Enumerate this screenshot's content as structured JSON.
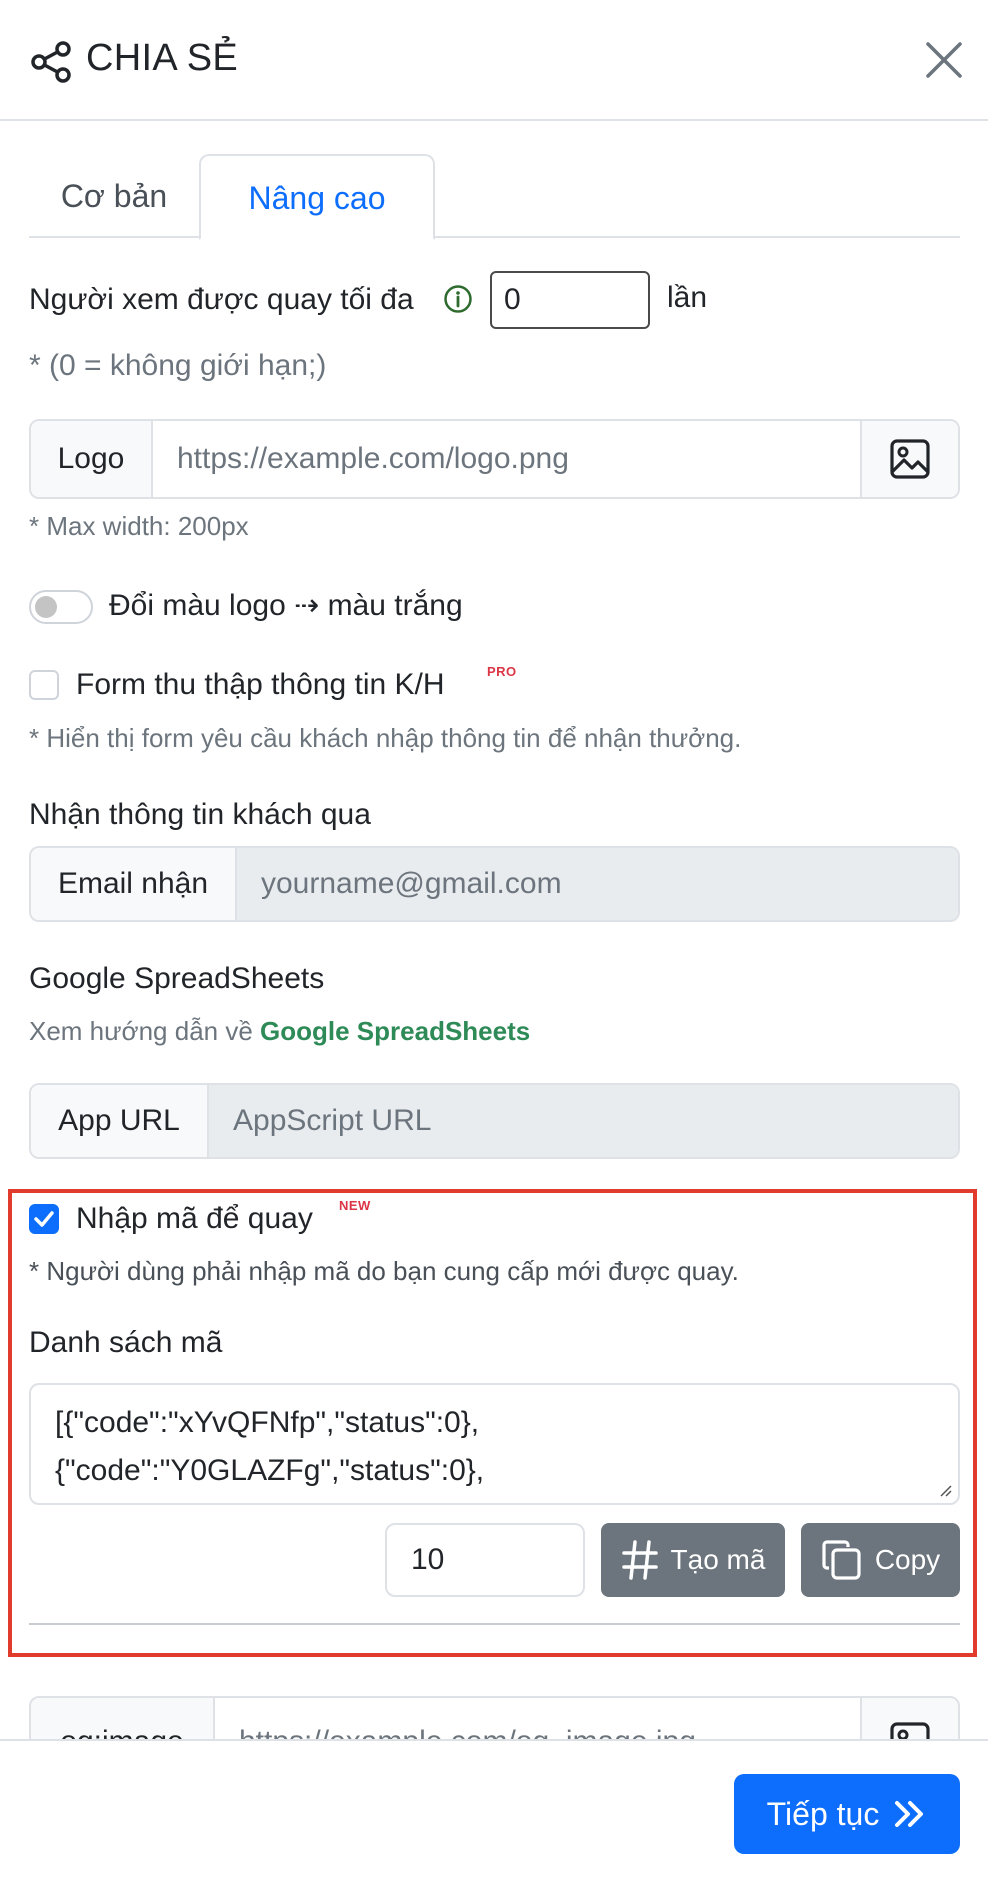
{
  "header": {
    "title": "CHIA SẺ",
    "share_icon": "share-icon",
    "close_icon": "close-icon"
  },
  "tabs": [
    {
      "label": "Cơ bản",
      "active": false
    },
    {
      "label": "Nâng cao",
      "active": true
    }
  ],
  "max_spins": {
    "label": "Người xem được quay tối đa",
    "value": "0",
    "suffix": "lần",
    "hint": "* (0 = không giới hạn;)"
  },
  "logo": {
    "label": "Logo",
    "placeholder": "https://example.com/logo.png",
    "hint": "* Max width: 200px",
    "button_icon": "image-icon"
  },
  "logo_color": {
    "label": "Đổi màu logo ⇢ màu trắng",
    "on": false
  },
  "customer_form": {
    "label": "Form thu thập thông tin K/H",
    "badge": "PRO",
    "checked": false,
    "hint": "* Hiển thị form yêu cầu khách nhập thông tin để nhận thưởng."
  },
  "receive_info": {
    "heading": "Nhận thông tin khách qua",
    "email_label": "Email nhận",
    "email_placeholder": "yourname@gmail.com"
  },
  "google_sheets": {
    "heading": "Google SpreadSheets",
    "guide_prefix": "Xem hướng dẫn về ",
    "guide_link": "Google SpreadSheets",
    "app_url_label": "App URL",
    "app_url_placeholder": "AppScript URL"
  },
  "code_entry": {
    "label": "Nhập mã để quay",
    "badge": "NEW",
    "checked": true,
    "hint": "* Người dùng phải nhập mã do bạn cung cấp mới được quay.",
    "list_heading": "Danh sách mã",
    "list_lines": [
      "[{\"code\":\"xYvQFNfp\",\"status\":0},",
      "{\"code\":\"Y0GLAZFg\",\"status\":0},"
    ],
    "count_value": "10",
    "generate_label": "Tạo mã",
    "copy_label": "Copy"
  },
  "og_image": {
    "label": "og:image",
    "placeholder": "https://example.com/og_image.jpg"
  },
  "footer": {
    "continue_label": "Tiếp tục"
  },
  "colors": {
    "primary": "#0d6efd",
    "secondary": "#6c757d",
    "highlight": "#e03b2c",
    "link_green": "#2e8b57",
    "badge_red": "#dc3545"
  }
}
